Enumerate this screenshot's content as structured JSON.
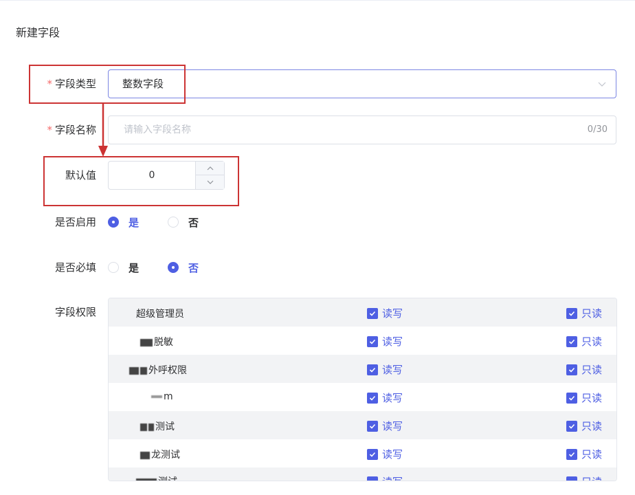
{
  "form": {
    "title": "新建字段",
    "required_mark": "*",
    "field_type": {
      "label": "字段类型",
      "value": "整数字段"
    },
    "field_name": {
      "label": "字段名称",
      "placeholder": "请输入字段名称",
      "counter": "0/30"
    },
    "default_value": {
      "label": "默认值",
      "value": "0"
    },
    "enabled": {
      "label": "是否启用",
      "options": [
        "是",
        "否"
      ],
      "selected": "是"
    },
    "required": {
      "label": "是否必填",
      "options": [
        "是",
        "否"
      ],
      "selected": "否"
    },
    "permissions": {
      "label": "字段权限",
      "rw_label": "读写",
      "ro_label": "只读",
      "rows": [
        {
          "name": "超级管理员"
        },
        {
          "name": "脱敏"
        },
        {
          "name": "外呼权限"
        },
        {
          "name": "m"
        },
        {
          "name": "测试"
        },
        {
          "name": "龙测试"
        },
        {
          "name": "测试"
        }
      ]
    }
  },
  "colors": {
    "accent": "#4e5fe3",
    "annotation": "#cc3333",
    "required": "#f56c6c"
  }
}
